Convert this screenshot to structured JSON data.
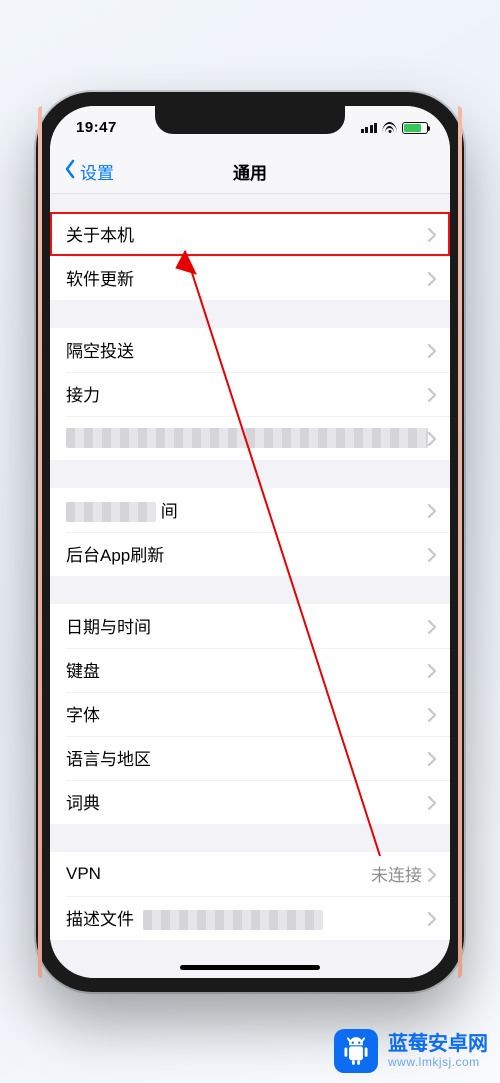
{
  "statusbar": {
    "time": "19:47"
  },
  "nav": {
    "back": "设置",
    "title": "通用"
  },
  "groups": [
    {
      "rows": [
        {
          "label": "关于本机",
          "highlight": true
        },
        {
          "label": "软件更新"
        }
      ]
    },
    {
      "rows": [
        {
          "label": "隔空投送"
        },
        {
          "label": "接力"
        },
        {
          "censored": true
        }
      ]
    },
    {
      "rows": [
        {
          "censored_partial": true,
          "suffix": "间"
        },
        {
          "label": "后台App刷新"
        }
      ]
    },
    {
      "rows": [
        {
          "label": "日期与时间"
        },
        {
          "label": "键盘"
        },
        {
          "label": "字体"
        },
        {
          "label": "语言与地区"
        },
        {
          "label": "词典"
        }
      ]
    },
    {
      "rows": [
        {
          "label": "VPN",
          "value": "未连接"
        },
        {
          "label_prefix": "描述文件",
          "censored_trailing": true
        }
      ]
    }
  ],
  "watermark": {
    "brand": "蓝莓安卓网",
    "url": "www.lmkjsj.com"
  }
}
